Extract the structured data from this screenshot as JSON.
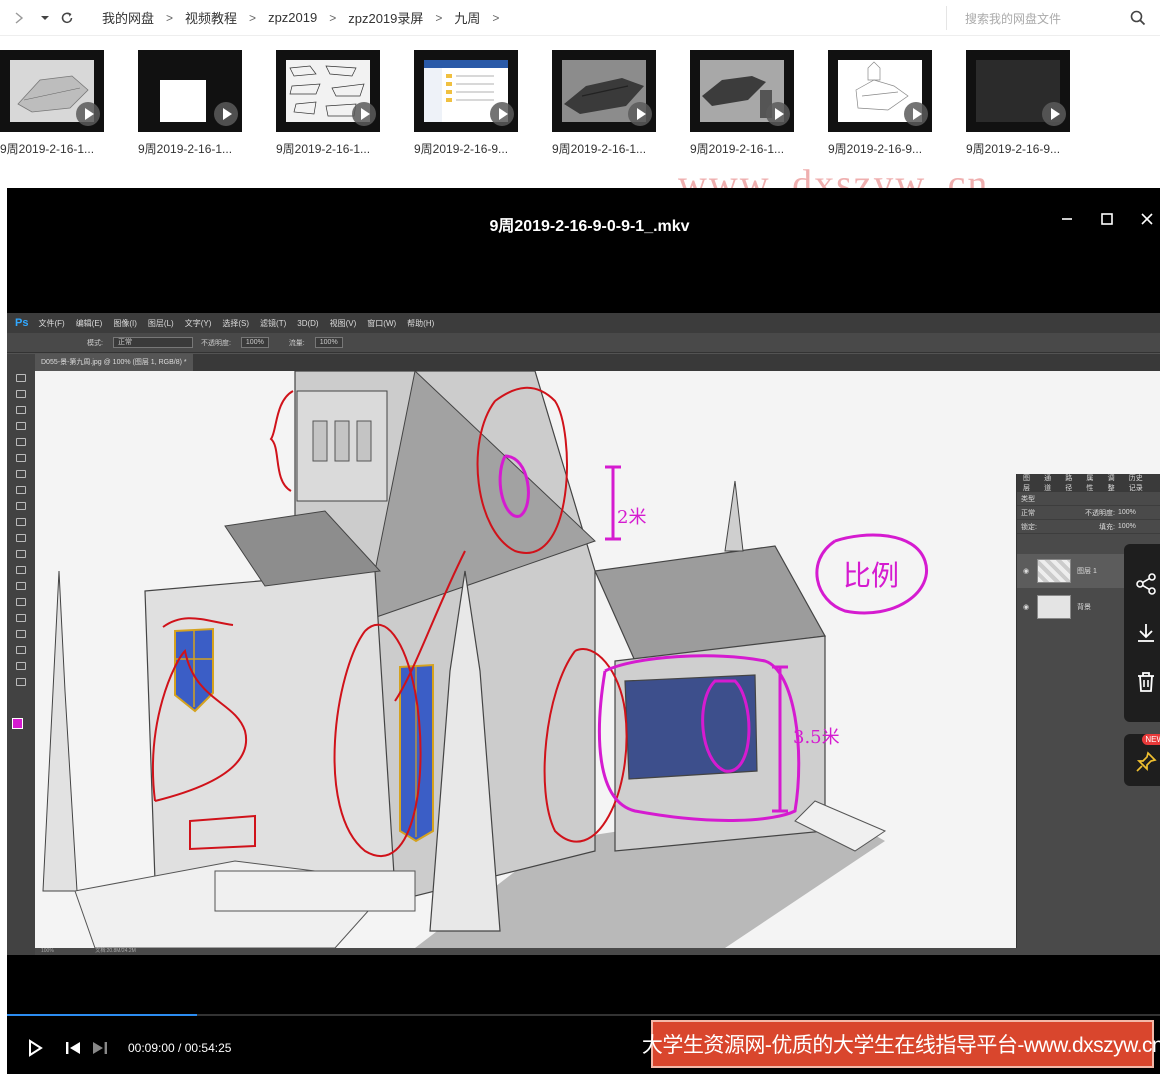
{
  "nav": {
    "crumbs": [
      "我的网盘",
      "视频教程",
      "zpz2019",
      "zpz2019录屏",
      "九周"
    ],
    "separator": ">",
    "search_placeholder": "搜索我的网盘文件"
  },
  "thumbnails": [
    {
      "name": "9周2019-2-16-1..."
    },
    {
      "name": "9周2019-2-16-1..."
    },
    {
      "name": "9周2019-2-16-1..."
    },
    {
      "name": "9周2019-2-16-9..."
    },
    {
      "name": "9周2019-2-16-1..."
    },
    {
      "name": "9周2019-2-16-1..."
    },
    {
      "name": "9周2019-2-16-9..."
    },
    {
      "name": "9周2019-2-16-9..."
    }
  ],
  "watermark_top": "www. dxszyw. cn",
  "player": {
    "title": "9周2019-2-16-9-0-9-1_.mkv",
    "current_time": "00:09:00",
    "total_time": "00:54:25",
    "time_separator": " / ",
    "progress": 0.165
  },
  "photoshop": {
    "logo": "Ps",
    "menu": [
      "文件(F)",
      "编辑(E)",
      "图像(I)",
      "图层(L)",
      "文字(Y)",
      "选择(S)",
      "滤镜(T)",
      "3D(D)",
      "视图(V)",
      "窗口(W)",
      "帮助(H)"
    ],
    "options": {
      "mode_label": "模式:",
      "mode_value": "正常",
      "opacity_label": "不透明度:",
      "opacity_value": "100%",
      "flow_label": "流量:",
      "flow_value": "100%"
    },
    "doc_tab": "D055-景-第九周.jpg @ 100% (图层 1, RGB/8) *",
    "status": "100%",
    "status_doc": "文档:20.8M/24.2M",
    "layers_panel": {
      "tabs": [
        "图层",
        "通道",
        "路径",
        "属性",
        "调整",
        "历史记录"
      ],
      "kind_label": "类型",
      "blend_mode": "正常",
      "opacity_label": "不透明度:",
      "opacity_value": "100%",
      "lock_label": "锁定:",
      "fill_label": "填充:",
      "fill_value": "100%",
      "layers": [
        {
          "name": "图层 1"
        },
        {
          "name": "背景"
        }
      ]
    }
  },
  "annotations": {
    "note_height_2m": "2米",
    "note_height_3_5m": "3.5米",
    "note_ratio": "比例"
  },
  "banner": "大学生资源网-优质的大学生在线指导平台-www.dxszyw.cn",
  "side_badge": "NEW",
  "colors": {
    "accent_blue": "#2c8cf0",
    "banner_red": "#d9462d",
    "annot_magenta": "#d51bd0",
    "annot_red": "#d0121a"
  }
}
